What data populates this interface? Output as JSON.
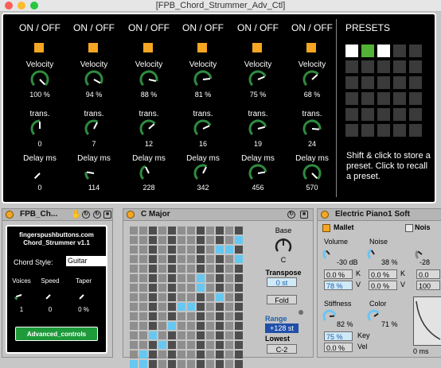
{
  "window": {
    "title": "[FPB_Chord_Strummer_Adv_Ctl]",
    "traffic_lights": [
      "#fc5f57",
      "#fdbc2e",
      "#27c840"
    ]
  },
  "colors": {
    "accent": "#f5a623",
    "preset_white": "#ffffff",
    "preset_green": "#53b336",
    "preset_dark": "#3a3a3a",
    "note_blue": "#66c8f0",
    "cell_dark": "#4d4d4d",
    "cell_light": "#8e8e8e",
    "value_blue": "#6cc4f2"
  },
  "strum": {
    "columns": [
      {
        "onoff": "ON / OFF",
        "velocity_label": "Velocity",
        "velocity": "100 %",
        "velocity_level": 1.0,
        "trans_label": "trans.",
        "trans": "0",
        "trans_level": 0.5,
        "delay_label": "Delay ms",
        "delay": "0",
        "delay_level": 0.0
      },
      {
        "onoff": "ON / OFF",
        "velocity_label": "Velocity",
        "velocity": "94 %",
        "velocity_level": 0.94,
        "trans_label": "trans.",
        "trans": "7",
        "trans_level": 0.6,
        "delay_label": "Delay ms",
        "delay": "114",
        "delay_level": 0.2
      },
      {
        "onoff": "ON / OFF",
        "velocity_label": "Velocity",
        "velocity": "88 %",
        "velocity_level": 0.88,
        "trans_label": "trans.",
        "trans": "12",
        "trans_level": 0.68,
        "delay_label": "Delay ms",
        "delay": "228",
        "delay_level": 0.4
      },
      {
        "onoff": "ON / OFF",
        "velocity_label": "Velocity",
        "velocity": "81 %",
        "velocity_level": 0.81,
        "trans_label": "trans.",
        "trans": "16",
        "trans_level": 0.74,
        "delay_label": "Delay ms",
        "delay": "342",
        "delay_level": 0.6
      },
      {
        "onoff": "ON / OFF",
        "velocity_label": "Velocity",
        "velocity": "75 %",
        "velocity_level": 0.75,
        "trans_label": "trans.",
        "trans": "19",
        "trans_level": 0.78,
        "delay_label": "Delay ms",
        "delay": "456",
        "delay_level": 0.8
      },
      {
        "onoff": "ON / OFF",
        "velocity_label": "Velocity",
        "velocity": "68 %",
        "velocity_level": 0.68,
        "trans_label": "trans.",
        "trans": "24",
        "trans_level": 0.85,
        "delay_label": "Delay ms",
        "delay": "570",
        "delay_level": 1.0
      }
    ]
  },
  "presets": {
    "title": "PRESETS",
    "slots": [
      "white",
      "green",
      "white",
      "dark",
      "dark",
      "dark",
      "dark",
      "dark",
      "dark",
      "dark",
      "dark",
      "dark",
      "dark",
      "dark",
      "dark",
      "dark",
      "dark",
      "dark",
      "dark",
      "dark",
      "dark",
      "dark",
      "dark",
      "dark",
      "dark",
      "dark",
      "dark",
      "dark",
      "dark",
      "dark"
    ],
    "info": "Shift & click  to store a preset. Click to recall a preset."
  },
  "device1": {
    "name": "FPB_Ch...",
    "brand": "fingerspushbuttons.com",
    "subtitle": "Chord_Strummer v1.1",
    "chord_style_label": "Chord Style:",
    "chord_style_value": "Guitar",
    "voices_label": "Voices",
    "voices": "1",
    "voices_level": 0.1,
    "speed_label": "Speed",
    "speed": "0",
    "speed_level": 0.0,
    "taper_label": "Taper",
    "taper": "0 %",
    "taper_level": 0.0,
    "advanced_button": "Advanced_controls"
  },
  "device2": {
    "name": "C Major",
    "base_label": "Base",
    "base": "C",
    "transpose_label": "Transpose",
    "transpose": "0 st",
    "fold_button": "Fold",
    "range_label": "Range",
    "range": "+128 st",
    "lowest_label": "Lowest",
    "lowest": "C-2",
    "note_grid": {
      "rows": 15,
      "cols": 12,
      "dark_pattern": [
        0,
        0,
        1,
        0,
        1,
        0,
        0,
        1,
        0,
        1,
        0,
        1
      ],
      "lit": [
        [
          1,
          11
        ],
        [
          2,
          9
        ],
        [
          2,
          10
        ],
        [
          3,
          11
        ],
        [
          5,
          7
        ],
        [
          6,
          7
        ],
        [
          7,
          9
        ],
        [
          8,
          5
        ],
        [
          8,
          6
        ],
        [
          10,
          4
        ],
        [
          11,
          2
        ],
        [
          12,
          3
        ],
        [
          13,
          1
        ],
        [
          14,
          0
        ],
        [
          14,
          1
        ]
      ]
    }
  },
  "device3": {
    "name": "Electric Piano1 Soft",
    "mallet_label": "Mallet",
    "noise_label": "Noise",
    "noise2_label": "Nois",
    "volume_label": "Volume",
    "volume": "-30 dB",
    "volume_level": 0.35,
    "noise_amount": "38 %",
    "noise_level": 0.38,
    "noise2_amount": "-28",
    "k1": "0.0 %",
    "k1_letter": "K",
    "v1": "78 %",
    "v1_letter": "V",
    "k2": "0.0 %",
    "k2_letter": "K",
    "v2": "0.0 %",
    "v2_letter": "V",
    "side1": "0.0",
    "side2": "100",
    "stiffness_label": "Stiffness",
    "stiffness": "82 %",
    "stiffness_level": 0.82,
    "color_label": "Color",
    "color": "71 %",
    "color_level": 0.71,
    "key_value": "75 %",
    "key_label": "Key",
    "vel_value": "0.0 %",
    "vel_label": "Vel",
    "side3": "0 ms"
  }
}
